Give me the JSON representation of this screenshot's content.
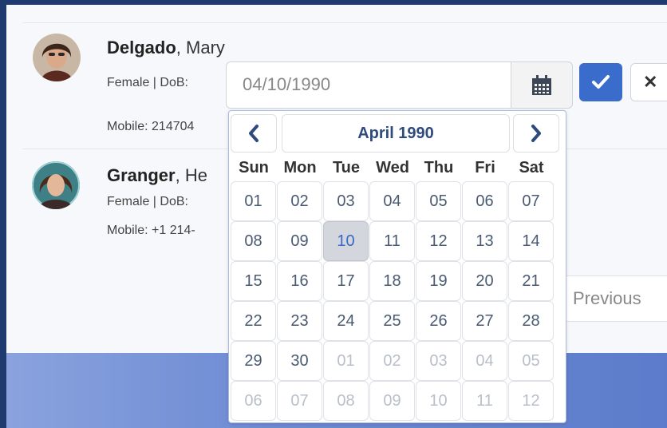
{
  "contacts": [
    {
      "last": "Delgado",
      "first": "Mary",
      "meta": "Female | DoB:",
      "mobile": "Mobile: 214704"
    },
    {
      "last": "Granger",
      "first": "He",
      "meta": "Female | DoB:",
      "mobile": "Mobile: +1 214-"
    }
  ],
  "dob_input": {
    "value": "04/10/1990"
  },
  "icons": {
    "calendar": "calendar-icon",
    "confirm": "check-icon",
    "cancel": "close-icon"
  },
  "pagination": {
    "previous_label": "Previous"
  },
  "calendar": {
    "month_label": "April 1990",
    "weekdays": [
      "Sun",
      "Mon",
      "Tue",
      "Wed",
      "Thu",
      "Fri",
      "Sat"
    ],
    "weeks": [
      [
        {
          "d": "01",
          "o": false
        },
        {
          "d": "02",
          "o": false
        },
        {
          "d": "03",
          "o": false
        },
        {
          "d": "04",
          "o": false
        },
        {
          "d": "05",
          "o": false
        },
        {
          "d": "06",
          "o": false
        },
        {
          "d": "07",
          "o": false
        }
      ],
      [
        {
          "d": "08",
          "o": false
        },
        {
          "d": "09",
          "o": false
        },
        {
          "d": "10",
          "o": false,
          "sel": true
        },
        {
          "d": "11",
          "o": false
        },
        {
          "d": "12",
          "o": false
        },
        {
          "d": "13",
          "o": false
        },
        {
          "d": "14",
          "o": false
        }
      ],
      [
        {
          "d": "15",
          "o": false
        },
        {
          "d": "16",
          "o": false
        },
        {
          "d": "17",
          "o": false
        },
        {
          "d": "18",
          "o": false
        },
        {
          "d": "19",
          "o": false
        },
        {
          "d": "20",
          "o": false
        },
        {
          "d": "21",
          "o": false
        }
      ],
      [
        {
          "d": "22",
          "o": false
        },
        {
          "d": "23",
          "o": false
        },
        {
          "d": "24",
          "o": false
        },
        {
          "d": "25",
          "o": false
        },
        {
          "d": "26",
          "o": false
        },
        {
          "d": "27",
          "o": false
        },
        {
          "d": "28",
          "o": false
        }
      ],
      [
        {
          "d": "29",
          "o": false
        },
        {
          "d": "30",
          "o": false
        },
        {
          "d": "01",
          "o": true
        },
        {
          "d": "02",
          "o": true
        },
        {
          "d": "03",
          "o": true
        },
        {
          "d": "04",
          "o": true
        },
        {
          "d": "05",
          "o": true
        }
      ],
      [
        {
          "d": "06",
          "o": true
        },
        {
          "d": "07",
          "o": true
        },
        {
          "d": "08",
          "o": true
        },
        {
          "d": "09",
          "o": true
        },
        {
          "d": "10",
          "o": true
        },
        {
          "d": "11",
          "o": true
        },
        {
          "d": "12",
          "o": true
        }
      ]
    ]
  },
  "colors": {
    "primary": "#3a6ccc",
    "selected_day_bg": "#d4d6dd",
    "band": "#5c7ccb"
  }
}
